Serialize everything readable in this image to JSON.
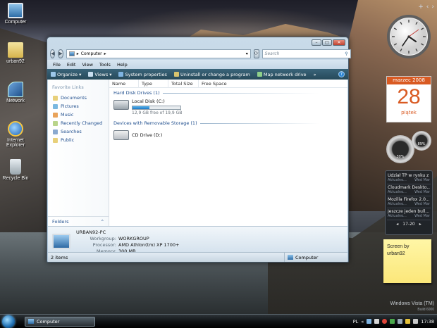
{
  "desktop": {
    "icons": [
      {
        "label": "Computer",
        "icon": "computer-icon"
      },
      {
        "label": "urban92",
        "icon": "user-folder-icon"
      },
      {
        "label": "Network",
        "icon": "network-icon"
      },
      {
        "label": "Internet Explorer",
        "icon": "internet-explorer-icon"
      },
      {
        "label": "Recycle Bin",
        "icon": "recycle-bin-icon"
      }
    ]
  },
  "window": {
    "address": {
      "location": "Computer"
    },
    "search_placeholder": "Search",
    "menu": [
      "File",
      "Edit",
      "View",
      "Tools",
      "Help"
    ],
    "toolbar": [
      "Organize",
      "Views",
      "System properties",
      "Uninstall or change a program",
      "Map network drive"
    ],
    "columns": [
      "Name",
      "Type",
      "Total Size",
      "Free Space"
    ],
    "favorites_title": "Favorite Links",
    "favorites": [
      "Documents",
      "Pictures",
      "Music",
      "Recently Changed",
      "Searches",
      "Public"
    ],
    "folders_label": "Folders",
    "groups": [
      {
        "title": "Hard Disk Drives (1)",
        "items": [
          {
            "name": "Local Disk (C:)",
            "free": "12,9 GB free of 19,9 GB",
            "used_fraction": 0.35
          }
        ]
      },
      {
        "title": "Devices with Removable Storage (1)",
        "items": [
          {
            "name": "CD Drive (D:)"
          }
        ]
      }
    ],
    "details": {
      "computer_name": "URBAN92-PC",
      "rows": [
        {
          "label": "Workgroup:",
          "value": "WORKGROUP"
        },
        {
          "label": "Processor:",
          "value": "AMD Athlon(tm) XP 1700+"
        },
        {
          "label": "Memory:",
          "value": "300 MB"
        }
      ]
    },
    "status": {
      "count": "2 items",
      "location": "Computer"
    }
  },
  "gadgets": {
    "calendar": {
      "month": "marzec 2008",
      "day": "28",
      "weekday": "piątek"
    },
    "meters": {
      "cpu": "30%",
      "memory": "89%"
    },
    "feeds": [
      {
        "title": "Udział TP w rynku z ...",
        "meta": "Aktualno...",
        "date": "Wed Mar"
      },
      {
        "title": "Cloudmark Deskto...",
        "meta": "Aktualno...",
        "date": "Wed Mar"
      },
      {
        "title": "Mozilla Firefox 2.0....",
        "meta": "Aktualno...",
        "date": "Wed Mar"
      },
      {
        "title": "Jeszcze jeden bull...",
        "meta": "Aktualno...",
        "date": "Wed Mar"
      }
    ],
    "feed_page": "17-20",
    "note": "Screen by urban92"
  },
  "watermark": {
    "line1": "Windows Vista (TM)",
    "line2": "Build 6000"
  },
  "taskbar": {
    "task": "Computer",
    "language": "PL",
    "time": "17:38"
  }
}
